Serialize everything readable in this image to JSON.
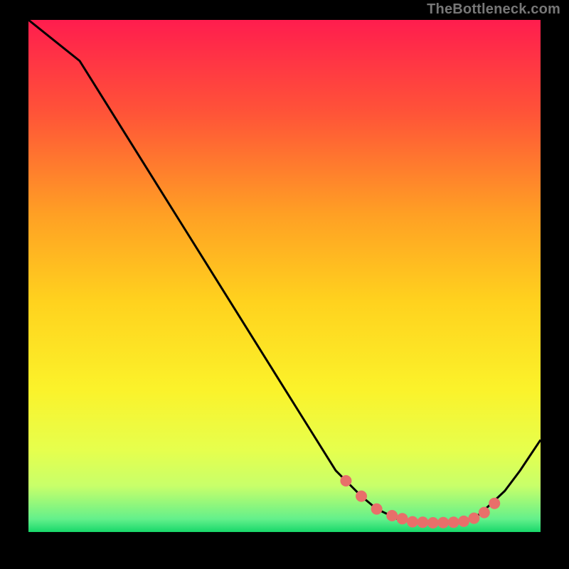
{
  "attribution": "TheBottleneck.com",
  "chart_data": {
    "type": "line",
    "title": "",
    "xlabel": "",
    "ylabel": "",
    "xlim": [
      0,
      100
    ],
    "ylim": [
      0,
      100
    ],
    "x": [
      0,
      5,
      10,
      15,
      20,
      25,
      30,
      35,
      40,
      45,
      50,
      55,
      60,
      62,
      65,
      68,
      72,
      75,
      78,
      80,
      83,
      86,
      88,
      90,
      93,
      96,
      100
    ],
    "y": [
      100,
      96,
      92,
      84,
      76,
      68,
      60,
      52,
      44,
      36,
      28,
      20,
      12,
      10,
      7,
      4.5,
      2.6,
      2.0,
      1.8,
      1.8,
      1.9,
      2.4,
      3.4,
      5.2,
      8.0,
      12,
      18
    ],
    "markers": {
      "x": [
        62,
        65,
        68,
        71,
        73,
        75,
        77,
        79,
        81,
        83,
        85,
        87,
        89,
        91
      ],
      "y": [
        10,
        7,
        4.5,
        3.2,
        2.6,
        2.0,
        1.9,
        1.8,
        1.85,
        1.9,
        2.1,
        2.7,
        3.8,
        5.6
      ]
    },
    "gradient_stops": [
      {
        "offset": 0.0,
        "color": "#ff1d4e"
      },
      {
        "offset": 0.18,
        "color": "#ff5338"
      },
      {
        "offset": 0.38,
        "color": "#ffa024"
      },
      {
        "offset": 0.55,
        "color": "#ffd21e"
      },
      {
        "offset": 0.72,
        "color": "#fbf22a"
      },
      {
        "offset": 0.84,
        "color": "#e6ff4d"
      },
      {
        "offset": 0.91,
        "color": "#c8ff6a"
      },
      {
        "offset": 0.975,
        "color": "#63f08b"
      },
      {
        "offset": 1.0,
        "color": "#18d86a"
      }
    ],
    "curve_color": "#000000",
    "marker_color": "#e86f6a",
    "marker_radius_px": 8
  }
}
